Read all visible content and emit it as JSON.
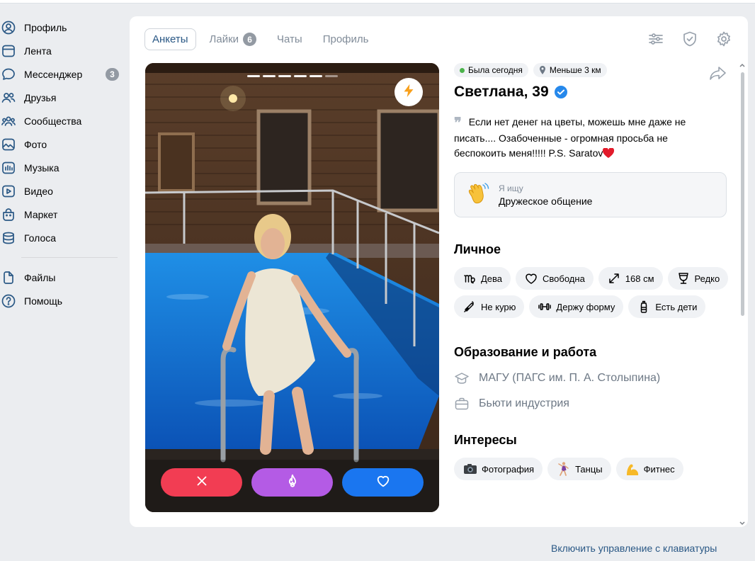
{
  "nav": {
    "items": [
      {
        "label": "Профиль",
        "icon": "user-circle-icon"
      },
      {
        "label": "Лента",
        "icon": "newsfeed-icon"
      },
      {
        "label": "Мессенджер",
        "icon": "chat-bubble-icon",
        "badge": "3"
      },
      {
        "label": "Друзья",
        "icon": "friends-icon"
      },
      {
        "label": "Сообщества",
        "icon": "communities-icon"
      },
      {
        "label": "Фото",
        "icon": "photo-icon"
      },
      {
        "label": "Музыка",
        "icon": "music-icon"
      },
      {
        "label": "Видео",
        "icon": "video-icon"
      },
      {
        "label": "Маркет",
        "icon": "market-icon"
      },
      {
        "label": "Голоса",
        "icon": "votes-icon"
      }
    ],
    "secondary": [
      {
        "label": "Файлы",
        "icon": "file-icon"
      },
      {
        "label": "Помощь",
        "icon": "help-icon"
      }
    ]
  },
  "tabs": [
    {
      "label": "Анкеты",
      "active": true
    },
    {
      "label": "Лайки",
      "badge": "6"
    },
    {
      "label": "Чаты"
    },
    {
      "label": "Профиль"
    }
  ],
  "top_icons": [
    "filters-icon",
    "shield-check-icon",
    "settings-gear-icon"
  ],
  "photo": {
    "segments_total": 6,
    "current_segment": 5
  },
  "profile": {
    "online_status": "Была сегодня",
    "distance": "Меньше 3 км",
    "name_age": "Светлана, 39",
    "quote_mark": "❞",
    "bio": "Если нет денег на цветы, можешь мне даже не писать.... Озабоченные - огромная просьба не беспокоить меня!!!!! P.S. Saratov",
    "seeking_title": "Я ищу",
    "seeking_value": "Дружеское общение"
  },
  "personal": {
    "title": "Личное",
    "chips": [
      {
        "label": "Дева",
        "icon": "virgo-icon"
      },
      {
        "label": "Свободна",
        "icon": "heart-outline-icon"
      },
      {
        "label": "168 см",
        "icon": "height-arrows-icon"
      },
      {
        "label": "Редко",
        "icon": "wine-glass-icon"
      },
      {
        "label": "Не курю",
        "icon": "no-smoking-icon"
      },
      {
        "label": "Держу форму",
        "icon": "dumbbell-icon"
      },
      {
        "label": "Есть дети",
        "icon": "baby-bottle-icon"
      }
    ]
  },
  "education": {
    "title": "Образование и работа",
    "university": "МАГУ (ПАГС им. П. А. Столыпина)",
    "work": "Бьюти индустрия"
  },
  "interests": {
    "title": "Интересы",
    "chips": [
      {
        "label": "Фотография",
        "icon": "camera-emoji-icon"
      },
      {
        "label": "Танцы",
        "icon": "dancer-emoji-icon"
      },
      {
        "label": "Фитнес",
        "icon": "flexed-biceps-emoji-icon"
      }
    ]
  },
  "footer": {
    "keyboard_link": "Включить управление с клавиатуры"
  },
  "colors": {
    "accent": "#2a5885",
    "dislike": "#f23d53",
    "superlike": "#b45be5",
    "like": "#1a76f0",
    "online": "#4bb34b"
  }
}
